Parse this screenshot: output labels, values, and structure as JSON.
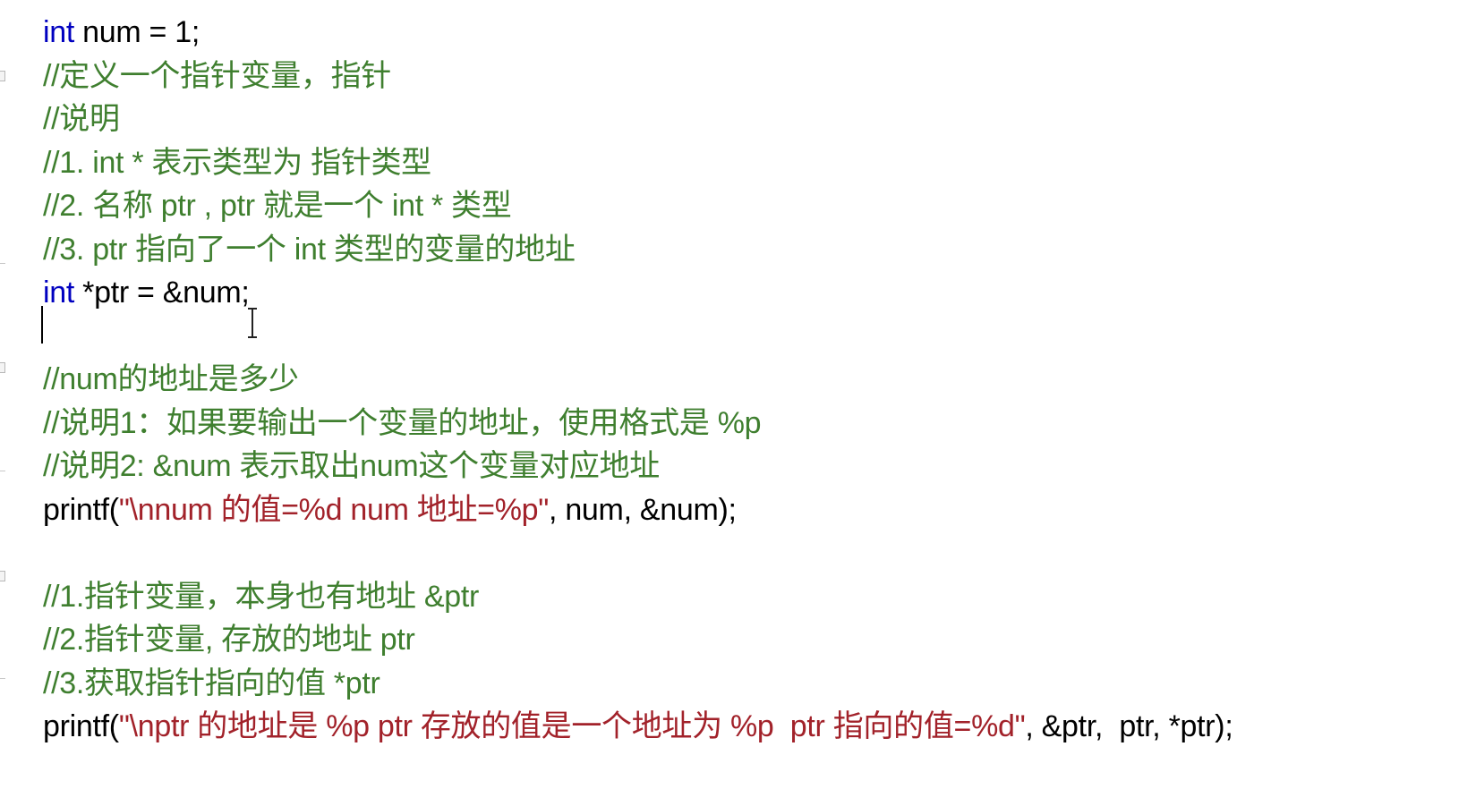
{
  "colors": {
    "keyword": "#0000c0",
    "comment": "#3f7f2f",
    "string": "#a2222a",
    "plain": "#000000",
    "background": "#ffffff"
  },
  "code": {
    "l1_kw": "int",
    "l1_rest": " num = 1;",
    "l2": "//定义一个指针变量，指针",
    "l3": "//说明",
    "l4": "//1. int * 表示类型为 指针类型",
    "l5": "//2. 名称 ptr , ptr 就是一个 int * 类型",
    "l6": "//3. ptr 指向了一个 int 类型的变量的地址",
    "l7_kw": "int",
    "l7_rest": " *ptr = &num;",
    "l8": "",
    "l9": "//num的地址是多少",
    "l10": "//说明1：如果要输出一个变量的地址，使用格式是 %p",
    "l11": "//说明2: &num 表示取出num这个变量对应地址",
    "l12_fn": "printf(",
    "l12_str": "\"\\nnum 的值=%d num 地址=%p\"",
    "l12_rest": ", num, &num);",
    "l13": "",
    "l14": "//1.指针变量，本身也有地址 &ptr",
    "l15": "//2.指针变量, 存放的地址 ptr",
    "l16": "//3.获取指针指向的值 *ptr",
    "l17_fn": "printf(",
    "l17_str": "\"\\nptr 的地址是 %p ptr 存放的值是一个地址为 %p  ptr 指向的值=%d\"",
    "l17_rest": ", &ptr,  ptr, *ptr);"
  }
}
